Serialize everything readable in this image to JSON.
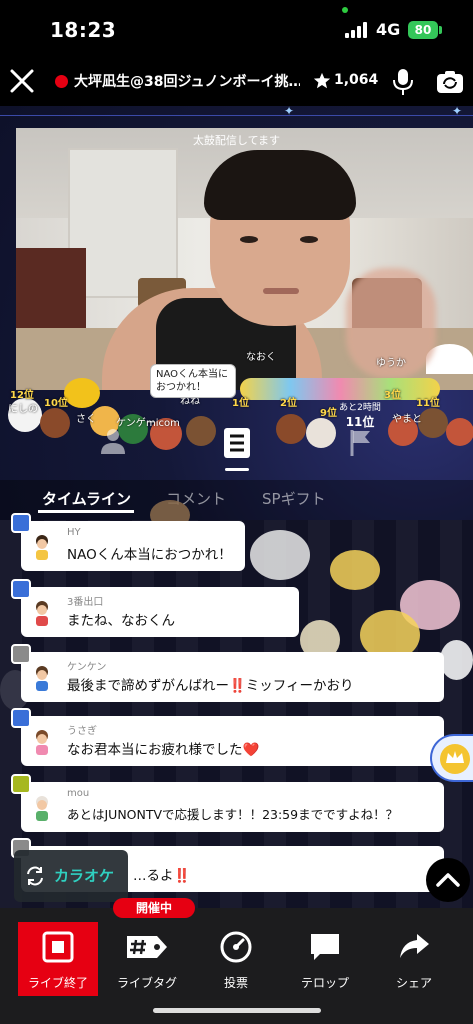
{
  "status_bar": {
    "time": "18:23",
    "network": "4G",
    "battery": "80"
  },
  "header": {
    "title": "大坪凪生@38回ジュノンボーイ挑…",
    "star_count": "1,064"
  },
  "stream": {
    "caption": "太鼓配信してます",
    "gift_message": "NAOくん本当におつかれ！",
    "rank_remaining": "あと2時間",
    "rank_position": "11位",
    "ranks": [
      "12位",
      "10位",
      "1位",
      "2位",
      "3位",
      "9位",
      "11位"
    ],
    "crowd_names": [
      "にしの",
      "さく",
      "ケンゲー",
      "micom",
      "ねね",
      "なおく",
      "ゆうか",
      "やまと"
    ]
  },
  "tabs": [
    {
      "label": "タイムライン",
      "active": true
    },
    {
      "label": "コメント",
      "active": false
    },
    {
      "label": "SPギフト",
      "active": false
    }
  ],
  "comments": [
    {
      "user": "HY",
      "text": "NAOくん本当におつかれ！",
      "badge_color": "#3a6fd8"
    },
    {
      "user": "3番出口",
      "text": "またね、なおくん",
      "badge_color": "#3a6fd8"
    },
    {
      "user": "ケンケン",
      "text": "最後まで諦めずがんばれー‼️ミッフィーかおり",
      "badge_color": "#8a8a8a"
    },
    {
      "user": "うさぎ",
      "text": "なお君本当にお疲れ様でした❤️",
      "badge_color": "#3a6fd8"
    },
    {
      "user": "mou",
      "text": "あとはJUNONTVで応援します！！23:59までですよね！？",
      "badge_color": "#a6b820"
    },
    {
      "user": "",
      "text": "…るよ‼️",
      "badge_color": "#8a8a8a"
    }
  ],
  "karaoke": {
    "label": "カラオケ"
  },
  "bottom_bar": {
    "live_badge": "開催中",
    "items": [
      {
        "label": "ライブ終了",
        "icon": "stop-icon"
      },
      {
        "label": "ライブタグ",
        "icon": "hashtag-tag-icon"
      },
      {
        "label": "投票",
        "icon": "vote-dial-icon"
      },
      {
        "label": "テロップ",
        "icon": "speech-bubble-icon"
      },
      {
        "label": "シェア",
        "icon": "share-arrow-icon"
      }
    ]
  },
  "colors": {
    "accent_red": "#e60012",
    "karaoke_teal": "#2fd0c0",
    "battery_green": "#34c759"
  }
}
